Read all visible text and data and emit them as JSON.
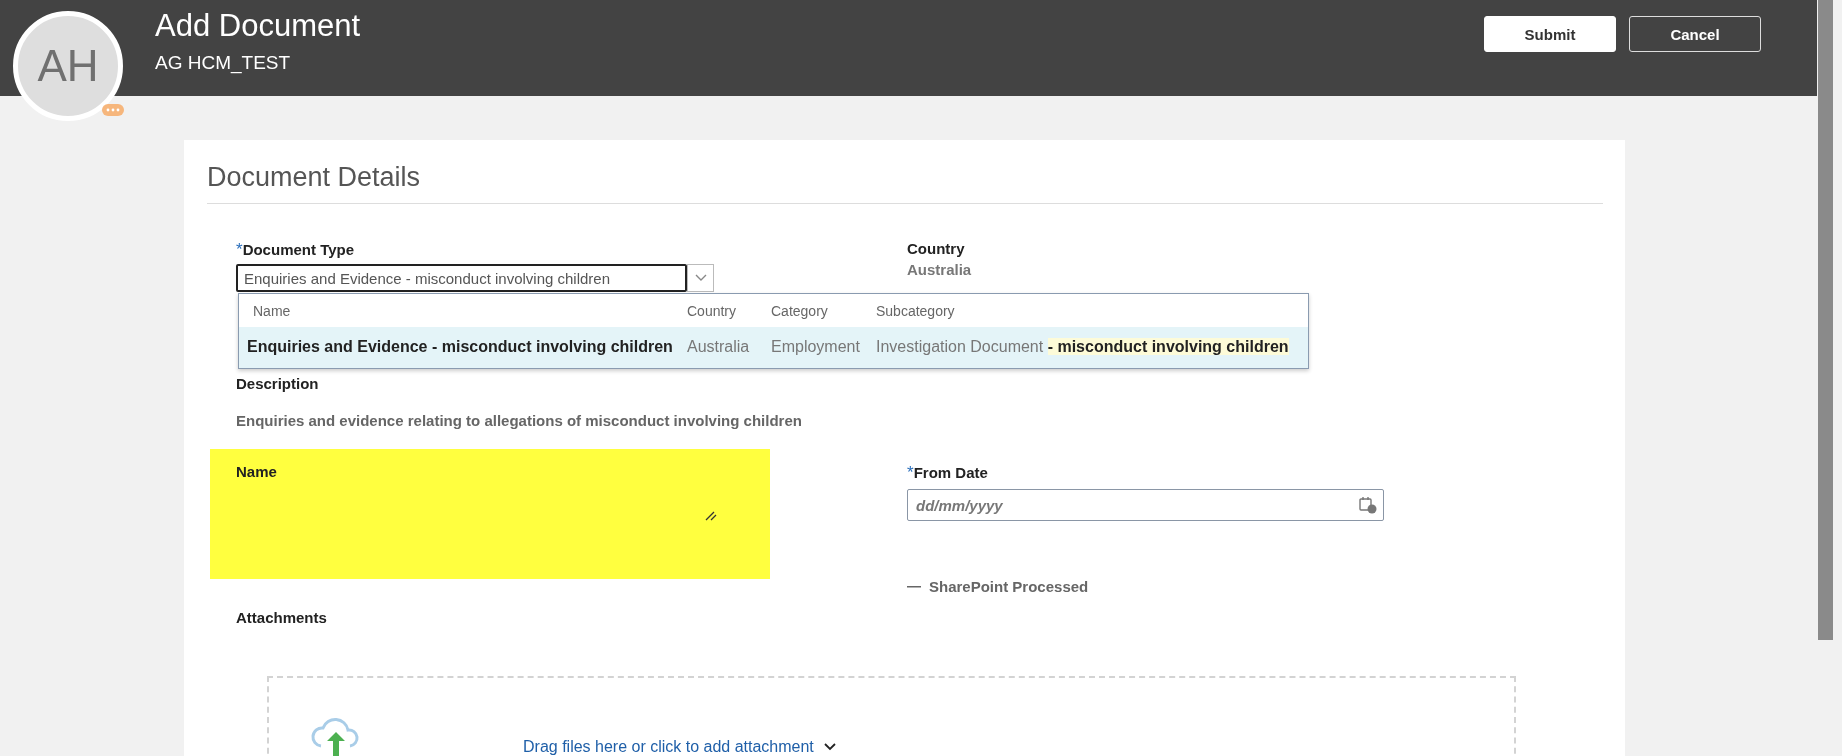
{
  "header": {
    "initials": "AH",
    "title": "Add Document",
    "subtitle": "AG HCM_TEST",
    "buttons": [
      {
        "label": "Submit",
        "kind": "primary"
      },
      {
        "label": "Cancel",
        "kind": "secondary"
      }
    ]
  },
  "section": {
    "title": "Document Details"
  },
  "required_mark": "*",
  "document_type": {
    "label": "Document Type",
    "required": true,
    "value": "Enquiries and Evidence - misconduct involving children",
    "dropdown": {
      "columns": [
        "Name",
        "Country",
        "Category",
        "Subcategory"
      ],
      "rows": [
        {
          "selected": true,
          "cells": [
            "Enquiries and Evidence - misconduct involving children",
            "Australia",
            "Employment",
            "Investigation Document **- misconduct involving children**"
          ]
        }
      ]
    }
  },
  "country": {
    "label": "Country",
    "value": "Australia"
  },
  "description": {
    "label": "Description",
    "value": "Enquiries and evidence relating to allegations of misconduct involving children"
  },
  "name_field": {
    "label": "Name",
    "required": false
  },
  "from_date": {
    "label": "From Date",
    "required": true,
    "placeholder": "dd/mm/yyyy"
  },
  "sharepoint": {
    "label": "SharePoint Processed",
    "checked": false
  },
  "attachments": {
    "label": "Attachments",
    "drop_text": "Drag files here or click to add attachment"
  }
}
